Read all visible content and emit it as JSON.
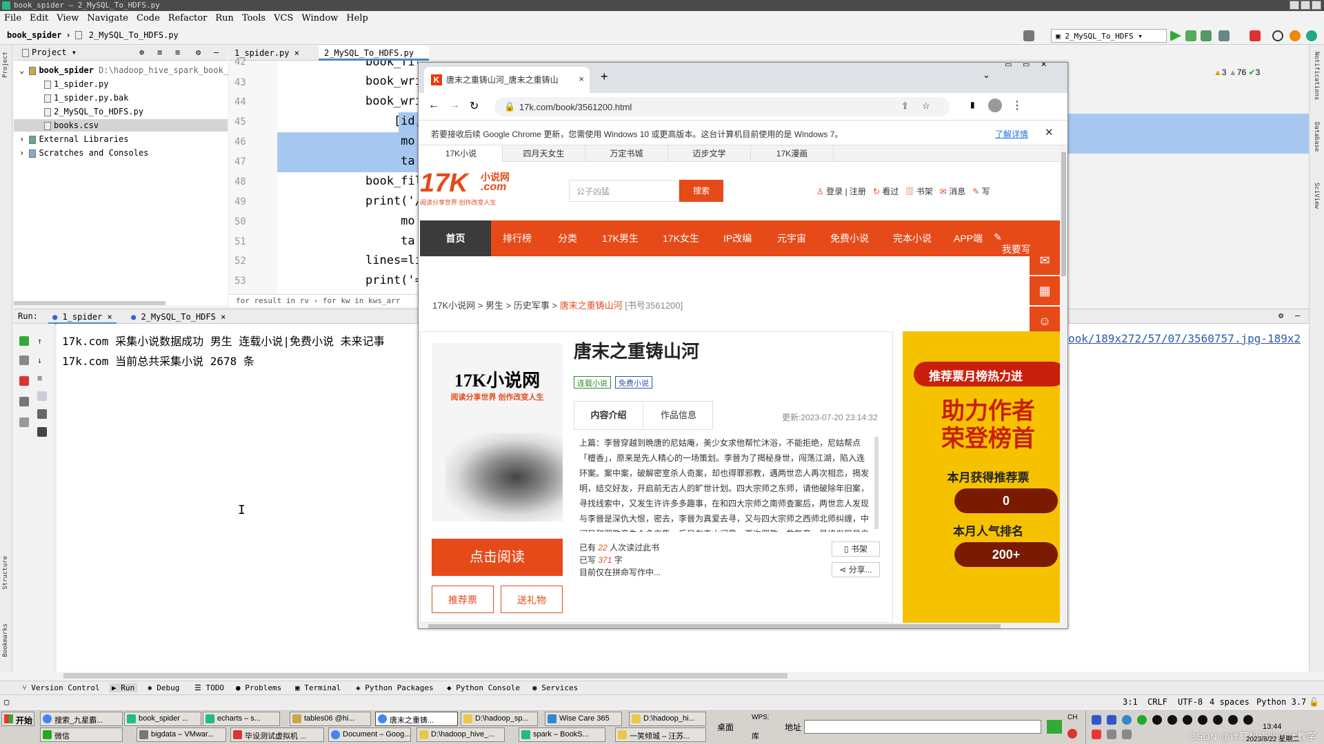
{
  "window": {
    "title": "book_spider – 2_MySQL_To_HDFS.py"
  },
  "menu": [
    "File",
    "Edit",
    "View",
    "Navigate",
    "Code",
    "Refactor",
    "Run",
    "Tools",
    "VCS",
    "Window",
    "Help"
  ],
  "nav": {
    "project": "book_spider",
    "file": "2_MySQL_To_HDFS.py",
    "run_config": "2_MySQL_To_HDFS"
  },
  "inspections": {
    "warn1": "3",
    "warn2": "76",
    "ok": "3"
  },
  "project_panel": {
    "title": "Project",
    "root": "book_spider",
    "root_path": "D:\\hadoop_hive_spark_book_",
    "files": [
      "1_spider.py",
      "1_spider.py.bak",
      "2_MySQL_To_HDFS.py",
      "books.csv"
    ],
    "external": "External Libraries",
    "scratches": "Scratches and Consoles"
  },
  "editor": {
    "tabs": [
      "1_spider.py",
      "2_MySQL_To_HDFS.py"
    ],
    "lines": [
      {
        "no": "42",
        "text": "book_fil"
      },
      {
        "no": "43",
        "text": "book_wri"
      },
      {
        "no": "44",
        "text": "book_wri"
      },
      {
        "no": "45",
        "text": "    [id,"
      },
      {
        "no": "46",
        "text": "     mo"
      },
      {
        "no": "47",
        "text": "     ta"
      },
      {
        "no": "48",
        "text": "book_fil"
      },
      {
        "no": "49",
        "text": "print('/"
      },
      {
        "no": "50",
        "text": "     mo"
      },
      {
        "no": "51",
        "text": "     ta"
      },
      {
        "no": "52",
        "text": "lines=li"
      },
      {
        "no": "53",
        "text": "print('="
      }
    ],
    "breadcrumb": "for result in rv  ›  for kw in kws_arr"
  },
  "run": {
    "label": "Run:",
    "tabs": [
      "1_spider",
      "2_MySQL_To_HDFS"
    ],
    "lines": [
      "17k.com 采集小说数据成功 男生 连载小说|免费小说 未来记事",
      "17k.com 当前总共采集小说 2678 条"
    ],
    "link": "ook/189x272/57/07/3560757.jpg-189x2"
  },
  "bottom_tools": [
    "Version Control",
    "Run",
    "Debug",
    "TODO",
    "Problems",
    "Terminal",
    "Python Packages",
    "Python Console",
    "Services"
  ],
  "status": {
    "pos": "3:1",
    "eol": "CRLF",
    "enc": "UTF-8",
    "indent": "4 spaces",
    "interp": "Python 3.7"
  },
  "side_labels": {
    "project": "Project",
    "structure": "Structure",
    "bookmarks": "Bookmarks",
    "notifications": "Notifications",
    "database": "Database",
    "sciview": "SciView"
  },
  "browser": {
    "tab_title": "唐末之重铸山河_唐末之重铸山",
    "url": "17k.com/book/3561200.html",
    "info": "若要接收后续 Google Chrome 更新，您需使用 Windows 10 或更高版本。这台计算机目前使用的是 Windows 7。",
    "info_link": "了解详情",
    "subnav": [
      "17K小说",
      "四月天女生",
      "万定书城",
      "迈步文学",
      "17K漫画"
    ],
    "logo": "17K",
    "logo_cn": "小说网",
    "logo_com": ".com",
    "logo_slogan": "阅读分享世界  创作改变人生",
    "search_placeholder": "公子凶猛",
    "search_btn": "搜索",
    "user": [
      "登录",
      "注册",
      "看过",
      "书架",
      "消息",
      "写"
    ],
    "mainnav": [
      "首页",
      "排行榜",
      "分类",
      "17K男生",
      "17K女生",
      "IP改编",
      "元宇宙",
      "免费小说",
      "完本小说",
      "APP端",
      "我要写"
    ],
    "breadcrumb": [
      "17K小说网",
      "男生",
      "历史军事"
    ],
    "bc_current": "唐末之重铸山河",
    "bc_id": "[书号3561200]",
    "book": {
      "title": "唐末之重铸山河",
      "tags": [
        "连载小说",
        "免费小说"
      ],
      "cover_title": "17K小说网",
      "cover_sub": "阅读分享世界  创作改变人生",
      "tabs": [
        "内容介绍",
        "作品信息"
      ],
      "updated": "更新:2023-07-20 23:14:32",
      "desc": "上篇：李晉穿越到晩唐的尼姑庵，美少女求他帮忙沐浴，不能拒绝，尼姑帮点「檀香」，原来是先人精心的一场策划。李晉为了揭秘身世，闯荡江湖，陷入连环案。案中案，破解密室杀人奇案，却也得罪邪教，遇两世恋人再次相恋，揭发明，结交好友，开启前无古人的旷世计划。四大宗师之东师，请他破除年旧案，寻找线索中，又发生许许多多趣事，在和四大宗师之南师查案后，两世恋人发现与李晉是深仇大恨，密去，李晉为真爱去寻，又与四大宗师之西师北师纠缠，中间又和邪教产生众多交集，后又在泰山问鼎，再次邪教，救复帝，最终发现是自己是皇子，破谜题，继承皇位。下篇：接手破碎的晩唐江",
      "stats": {
        "read_pre": "已有",
        "read": "22",
        "read_post": "人次读过此书",
        "words_pre": "已写",
        "words": "371",
        "words_post": "字",
        "writing": "目前仅在拼命写作中..."
      },
      "shelf": "书架",
      "share": "分享...",
      "read_btn": "点击阅读",
      "vote_btn": "推荐票",
      "gift_btn": "送礼物"
    },
    "ad": {
      "banner": "推荐票月榜热力进",
      "line1": "助力作者",
      "line2": "荣登榜首",
      "month_votes": "本月获得推荐票",
      "votes_value": "0",
      "popularity": "本月人气排名",
      "rank_value": "200+"
    }
  },
  "taskbar": {
    "start": "开始",
    "row1": [
      "搜索_九星霸...",
      "book_spider ...",
      "echarts – s...",
      "tables06 @hi...",
      "唐末之重铸...",
      "D:\\hadoop_sp...",
      "Wise Care 365",
      "D:\\hadoop_hi..."
    ],
    "row2": [
      "微信",
      "bigdata – VMwar...",
      "毕设测试虚拟机 ...",
      "Document – Goog...",
      "D:\\hadoop_hive_...",
      "spark – BookS...",
      "一笑倾城 – 汪苏..."
    ],
    "desktop": "桌面",
    "wps": "WPS:",
    "lib": "库",
    "address": "地址",
    "lang": "CH",
    "time": "13:44",
    "date": "2023/8/22 星期二",
    "watermark": "CSDN @计算机毕业设计教学"
  },
  "colors": {
    "accent": "#e64a19",
    "ide_sel": "#a6c8f0",
    "link": "#2a58ad"
  }
}
